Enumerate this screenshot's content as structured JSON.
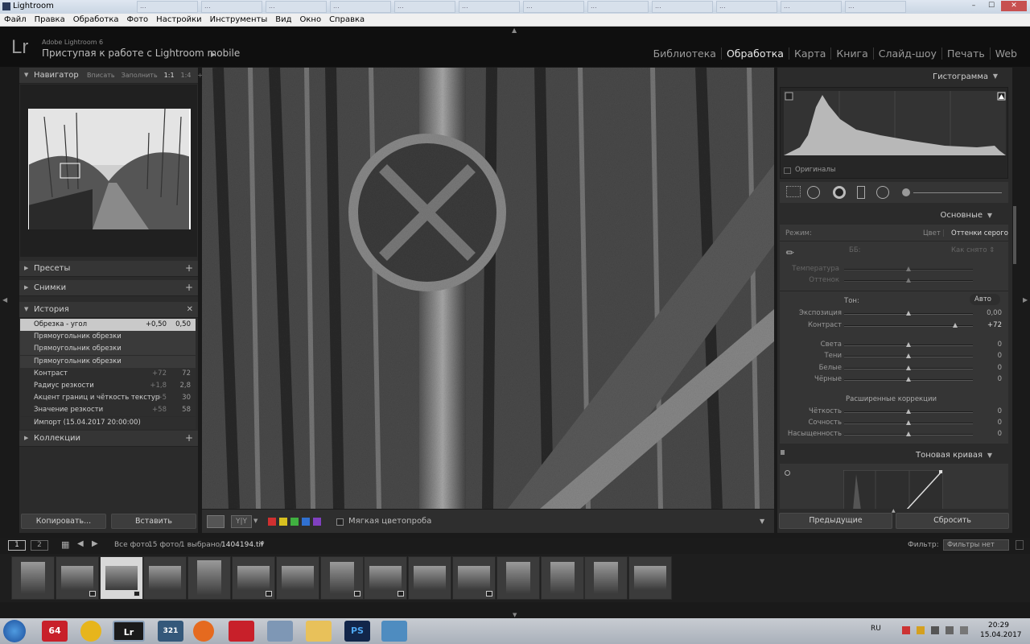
{
  "window": {
    "title": "Lightroom",
    "controls": [
      "–",
      "☐",
      "✕"
    ],
    "browser_tabs": [
      "...",
      "...",
      "...",
      "...",
      "...",
      "...",
      "...",
      "...",
      "...",
      "...",
      "...",
      "..."
    ]
  },
  "menu": [
    "Файл",
    "Правка",
    "Обработка",
    "Фото",
    "Настройки",
    "Инструменты",
    "Вид",
    "Окно",
    "Справка"
  ],
  "identity": {
    "logo": "Lr",
    "app_name": "Adobe Lightroom 6",
    "tagline": "Приступая к работе с Lightroom mobile"
  },
  "modules": [
    "Библиотека",
    "Обработка",
    "Карта",
    "Книга",
    "Слайд-шоу",
    "Печать",
    "Web"
  ],
  "active_module": "Обработка",
  "left": {
    "navigator": {
      "title": "Навигатор",
      "opts": [
        "Вписать",
        "Заполнить",
        "1:1",
        "1:4",
        "÷"
      ]
    },
    "presets": "Пресеты",
    "snapshots": "Снимки",
    "history": {
      "title": "История",
      "rows": [
        {
          "name": "Обрезка - угол",
          "v1": "+0,50",
          "v2": "0,50",
          "selected": true
        },
        {
          "name": "Прямоугольник обрезки",
          "v1": "",
          "v2": ""
        },
        {
          "name": "Прямоугольник обрезки",
          "v1": "",
          "v2": ""
        },
        {
          "name": "Прямоугольник обрезки",
          "v1": "",
          "v2": ""
        },
        {
          "name": "Контраст",
          "v1": "+72",
          "v2": "72"
        },
        {
          "name": "Радиус резкости",
          "v1": "+1,8",
          "v2": "2,8"
        },
        {
          "name": "Акцент границ и чёткость текстур",
          "v1": "+5",
          "v2": "30"
        },
        {
          "name": "Значение резкости",
          "v1": "+58",
          "v2": "58"
        },
        {
          "name": "Импорт (15.04.2017 20:00:00)",
          "v1": "",
          "v2": ""
        }
      ]
    },
    "collections": "Коллекции",
    "copy_btn": "Копировать...",
    "paste_btn": "Вставить"
  },
  "toolbar": {
    "yy": "Y|Y",
    "soft_proof": "Мягкая цветопроба",
    "flag_colors": [
      "#d03030",
      "#d8c020",
      "#40b040",
      "#3070d0",
      "#8040c0"
    ]
  },
  "right": {
    "histogram": {
      "title": "Гистограмма",
      "originals": "Оригиналы"
    },
    "basic": {
      "title": "Основные",
      "mode_label": "Режим:",
      "mode_color": "Цвет",
      "mode_gray": "Оттенки серого",
      "wb_label": "ББ:",
      "wb_value": "Как снято ⇕",
      "temp": "Температура",
      "tint": "Оттенок",
      "tone_label": "Тон:",
      "auto": "Авто",
      "sliders": [
        {
          "name": "Экспозиция",
          "value": "0,00",
          "pos": 0.5
        },
        {
          "name": "Контраст",
          "value": "+72",
          "pos": 0.86
        },
        {
          "name": "Света",
          "value": "0",
          "pos": 0.5
        },
        {
          "name": "Тени",
          "value": "0",
          "pos": 0.5
        },
        {
          "name": "Белые",
          "value": "0",
          "pos": 0.5
        },
        {
          "name": "Чёрные",
          "value": "0",
          "pos": 0.5
        },
        {
          "name": "Чёткость",
          "value": "0",
          "pos": 0.5
        },
        {
          "name": "Сочность",
          "value": "0",
          "pos": 0.5
        },
        {
          "name": "Насыщенность",
          "value": "0",
          "pos": 0.5
        }
      ],
      "ext_label": "Расширенные коррекции"
    },
    "tone_curve": "Тоновая кривая",
    "prev_btn": "Предыдущие",
    "reset_btn": "Сбросить"
  },
  "filmstrip": {
    "views": [
      "1",
      "2"
    ],
    "source": "Все фото",
    "count": "15 фото/",
    "selected": "1 выбрано/",
    "filename": "1404194.tif",
    "filter_label": "Фильтр:",
    "filter_value": "Фильтры нет",
    "thumbs": 15
  },
  "taskbar": {
    "items": [
      "64",
      "Lr",
      "321",
      "PS"
    ],
    "lang": "RU",
    "time": "20:29",
    "date": "15.04.2017"
  }
}
